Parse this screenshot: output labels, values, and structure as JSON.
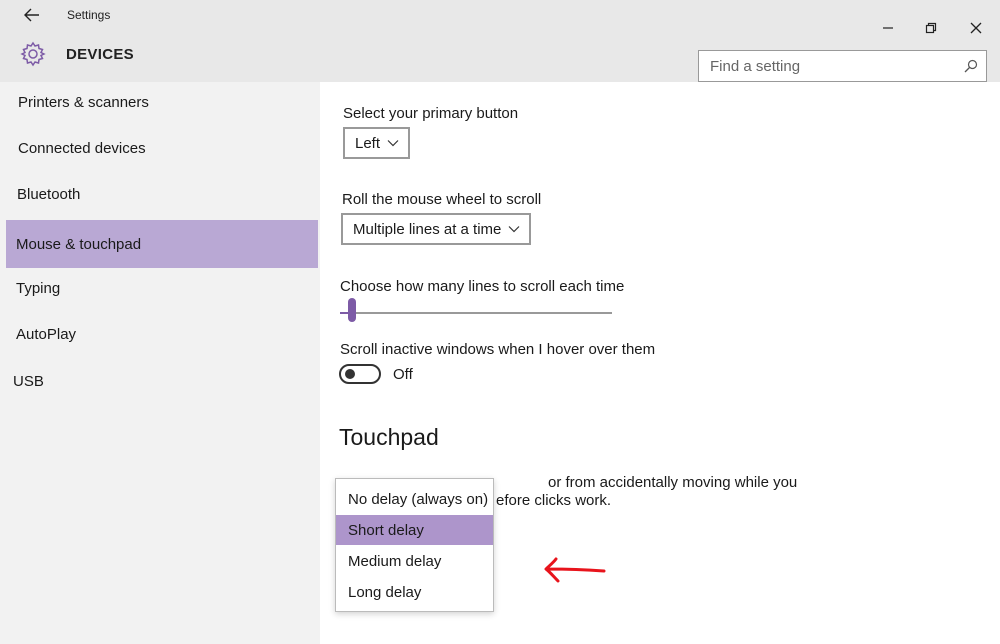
{
  "window": {
    "title": "Settings"
  },
  "header": {
    "section_title": "DEVICES",
    "search_placeholder": "Find a setting"
  },
  "sidebar": {
    "items": [
      {
        "label": "Printers & scanners",
        "active": false
      },
      {
        "label": "Connected devices",
        "active": false
      },
      {
        "label": "Bluetooth",
        "active": false
      },
      {
        "label": "Mouse & touchpad",
        "active": true
      },
      {
        "label": "Typing",
        "active": false
      },
      {
        "label": "AutoPlay",
        "active": false
      },
      {
        "label": "USB",
        "active": false
      }
    ]
  },
  "main": {
    "primary_button_label": "Select your primary button",
    "primary_button_value": "Left",
    "wheel_label": "Roll the mouse wheel to scroll",
    "wheel_value": "Multiple lines at a time",
    "lines_label": "Choose how many lines to scroll each time",
    "lines_value_fraction": 0.03,
    "inactive_label": "Scroll inactive windows when I hover over them",
    "inactive_state": "Off",
    "touchpad_heading": "Touchpad",
    "touchpad_desc_line1_end": "or from accidentally moving while you",
    "touchpad_desc_line2_end": "efore clicks work."
  },
  "dropdown": {
    "options": [
      {
        "label": "No delay (always on)",
        "selected": false
      },
      {
        "label": "Short delay",
        "selected": true
      },
      {
        "label": "Medium delay",
        "selected": false
      },
      {
        "label": "Long delay",
        "selected": false
      }
    ]
  },
  "colors": {
    "accent": "#7d5ba6",
    "sidebar_active": "#b9a8d4",
    "dropdown_selected": "#ad95cb",
    "annotation_arrow": "#e8141c"
  }
}
